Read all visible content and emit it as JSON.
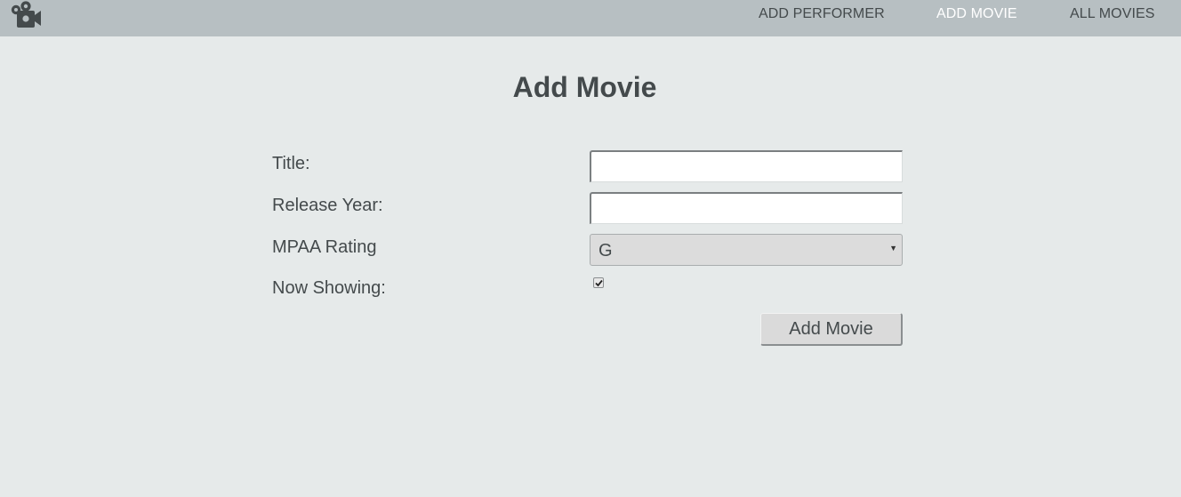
{
  "nav": {
    "items": [
      {
        "label": "ADD PERFORMER",
        "active": false
      },
      {
        "label": "ADD MOVIE",
        "active": true
      },
      {
        "label": "ALL MOVIES",
        "active": false
      }
    ]
  },
  "logo": {
    "icon": "movie-camera-icon"
  },
  "page": {
    "title": "Add Movie"
  },
  "form": {
    "title_label": "Title:",
    "title_value": "",
    "year_label": "Release Year:",
    "year_value": "",
    "rating_label": "MPAA Rating",
    "rating_selected": "G",
    "showing_label": "Now Showing:",
    "showing_checked": true,
    "submit_label": "Add Movie"
  },
  "colors": {
    "topbar": "#b7bfc2",
    "background": "#e6eaea",
    "text": "#444a4c",
    "nav_active": "#ffffff"
  }
}
